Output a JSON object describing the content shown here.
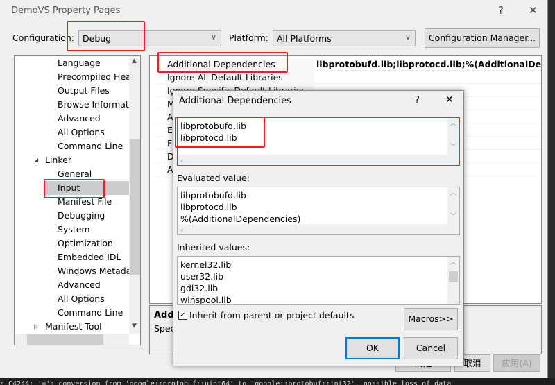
{
  "window": {
    "title": "DemoVS Property Pages",
    "help": "?",
    "close": "✕"
  },
  "config": {
    "label": "Configuration:",
    "value": "Debug",
    "platform_label": "Platform:",
    "platform_value": "All Platforms",
    "manager_button": "Configuration Manager..."
  },
  "tree": {
    "items": [
      {
        "label": "Language"
      },
      {
        "label": "Precompiled Head"
      },
      {
        "label": "Output Files"
      },
      {
        "label": "Browse Informati"
      },
      {
        "label": "Advanced"
      },
      {
        "label": "All Options"
      },
      {
        "label": "Command Line"
      },
      {
        "label": "Linker",
        "expander": "◢"
      },
      {
        "label": "General"
      },
      {
        "label": "Input",
        "selected": true
      },
      {
        "label": "Manifest File"
      },
      {
        "label": "Debugging"
      },
      {
        "label": "System"
      },
      {
        "label": "Optimization"
      },
      {
        "label": "Embedded IDL"
      },
      {
        "label": "Windows Metada"
      },
      {
        "label": "Advanced"
      },
      {
        "label": "All Options"
      },
      {
        "label": "Command Line"
      },
      {
        "label": "Manifest Tool",
        "expander": "▷"
      }
    ]
  },
  "grid": {
    "rows": [
      {
        "name": "Additional Dependencies",
        "value": "libprotobufd.lib;libprotocd.lib;%(AdditionalDependencies)"
      },
      {
        "name": "Ignore All Default Libraries",
        "value": ""
      },
      {
        "name": "Ignore Specific Default Libraries",
        "value": ""
      },
      {
        "name": "M",
        "value": ""
      },
      {
        "name": "A",
        "value": ""
      },
      {
        "name": "E",
        "value": ""
      },
      {
        "name": "F",
        "value": ""
      },
      {
        "name": "D",
        "value": ""
      },
      {
        "name": "A",
        "value": ""
      }
    ]
  },
  "description": {
    "title": "Addi",
    "text": "Spec"
  },
  "bottom_buttons": {
    "ok": "确定",
    "cancel": "取消",
    "apply": "应用(A)"
  },
  "dialog": {
    "title": "Additional Dependencies",
    "help": "?",
    "close": "✕",
    "edit_lines": [
      "libprotobufd.lib",
      "libprotocd.lib"
    ],
    "evaluated_label": "Evaluated value:",
    "evaluated_lines": [
      "libprotobufd.lib",
      "libprotocd.lib",
      "%(AdditionalDependencies)"
    ],
    "inherited_label": "Inherited values:",
    "inherited_lines": [
      "kernel32.lib",
      "user32.lib",
      "gdi32.lib",
      "winspool.lib"
    ],
    "inherit_checkbox": {
      "label": "Inherit from parent or project defaults",
      "checked": true
    },
    "macros_button": "Macros>>",
    "ok_button": "OK",
    "cancel_button": "Cancel"
  },
  "output": {
    "text": "s C4244: '=': conversion from 'google::protobuf::uint64' to 'google::protobuf::int32', possible loss of data"
  },
  "colors": {
    "highlight": "#ff1a1a",
    "focus": "#0078d7",
    "selection": "#cccccc"
  }
}
